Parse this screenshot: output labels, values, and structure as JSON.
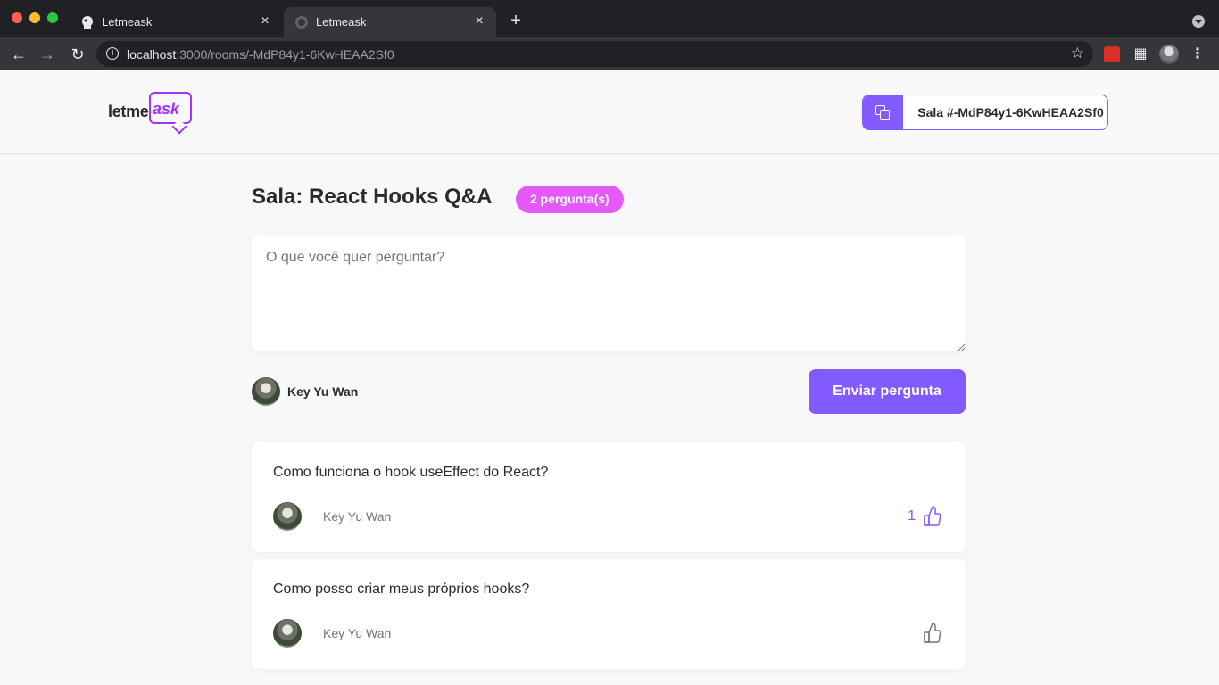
{
  "browser": {
    "tabs": [
      {
        "title": "Letmeask",
        "active": false
      },
      {
        "title": "Letmeask",
        "active": true
      }
    ],
    "new_tab": "+",
    "close": "×",
    "url_host": "localhost",
    "url_path": ":3000/rooms/-MdP84y1-6KwHEAA2Sf0"
  },
  "header": {
    "logo_text_1": "letme",
    "logo_text_2": "ask",
    "room_code_label": "Sala #-MdP84y1-6KwHEAA2Sf0"
  },
  "room": {
    "title": "Sala: React Hooks Q&A",
    "badge": "2 pergunta(s)"
  },
  "form": {
    "placeholder": "O que você quer perguntar?",
    "user_name": "Key Yu Wan",
    "submit_label": "Enviar pergunta"
  },
  "questions": [
    {
      "content": "Como funciona o hook useEffect do React?",
      "author": "Key Yu Wan",
      "like_count": "1",
      "liked": true
    },
    {
      "content": "Como posso criar meus próprios hooks?",
      "author": "Key Yu Wan",
      "like_count": "",
      "liked": false
    }
  ],
  "colors": {
    "primary": "#835afd",
    "badge": "#e559f9",
    "text": "#29292e",
    "muted": "#737380"
  },
  "icons": {
    "copy": "copy-icon",
    "like": "thumbs-up-icon"
  }
}
